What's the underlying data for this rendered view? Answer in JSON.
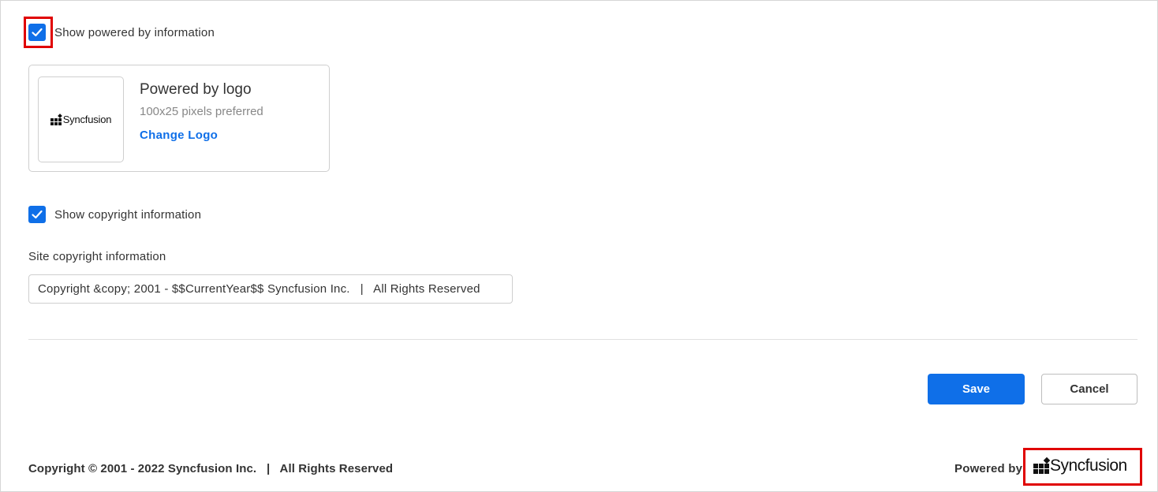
{
  "powered_by_option": {
    "checked": true,
    "label": "Show powered by information"
  },
  "logo_card": {
    "title": "Powered by logo",
    "hint": "100x25 pixels preferred",
    "change_link": "Change Logo",
    "logo_text": "Syncfusion"
  },
  "copyright_option": {
    "checked": true,
    "label": "Show copyright information"
  },
  "site_copyright": {
    "label": "Site copyright information",
    "value": "Copyright &copy; 2001 - $$CurrentYear$$ Syncfusion Inc.   |   All Rights Reserved"
  },
  "actions": {
    "save_label": "Save",
    "cancel_label": "Cancel"
  },
  "footer": {
    "copyright_text": "Copyright © 2001 - 2022 Syncfusion Inc.   |   All Rights Reserved",
    "powered_by_label": "Powered by",
    "logo_text": "Syncfusion"
  },
  "colors": {
    "accent": "#0f6fe8",
    "highlight": "#e00000"
  }
}
